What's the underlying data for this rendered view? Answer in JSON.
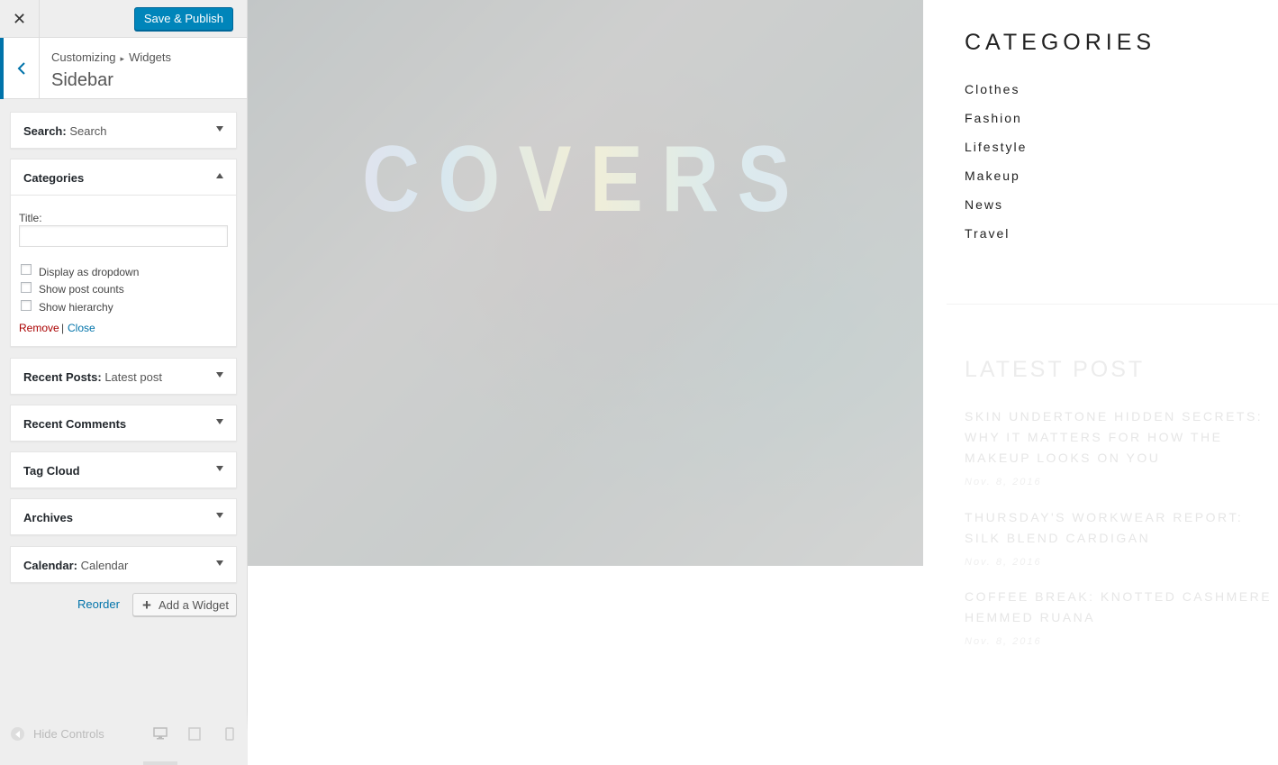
{
  "customizer": {
    "close_label": "✕",
    "publish_label": "Save & Publish",
    "breadcrumb": {
      "root": "Customizing",
      "separator": "▸",
      "current": "Widgets"
    },
    "section_title": "Sidebar",
    "widgets": [
      {
        "name": "Search",
        "subtitle": "Search",
        "expanded": false
      },
      {
        "name": "Categories",
        "subtitle": "",
        "expanded": true
      },
      {
        "name": "Recent Posts",
        "subtitle": "Latest post",
        "expanded": false
      },
      {
        "name": "Recent Comments",
        "subtitle": "",
        "expanded": false
      },
      {
        "name": "Tag Cloud",
        "subtitle": "",
        "expanded": false
      },
      {
        "name": "Archives",
        "subtitle": "",
        "expanded": false
      },
      {
        "name": "Calendar",
        "subtitle": "Calendar",
        "expanded": false
      }
    ],
    "categories_form": {
      "title_label": "Title:",
      "title_value": "",
      "options": [
        {
          "label": "Display as dropdown",
          "checked": false
        },
        {
          "label": "Show post counts",
          "checked": false
        },
        {
          "label": "Show hierarchy",
          "checked": false
        }
      ],
      "remove_label": "Remove",
      "divider": "|",
      "close_label": "Close"
    },
    "reorder_label": "Reorder",
    "add_widget_label": "Add a Widget",
    "hide_controls_label": "Hide Controls",
    "devices": [
      "desktop-icon",
      "tablet-icon",
      "mobile-icon"
    ]
  },
  "preview": {
    "hero_word": "COVERS",
    "categories_heading": "CATEGORIES",
    "categories": [
      "Clothes",
      "Fashion",
      "Lifestyle",
      "Makeup",
      "News",
      "Travel"
    ],
    "latest_heading": "LATEST POST",
    "posts": [
      {
        "title": "SKIN UNDERTONE HIDDEN SECRETS: WHY IT MATTERS FOR HOW THE MAKEUP LOOKS ON YOU",
        "date": "Nov. 8, 2016"
      },
      {
        "title": "THURSDAY'S WORKWEAR REPORT: SILK BLEND CARDIGAN",
        "date": "Nov. 8, 2016"
      },
      {
        "title": "COFFEE BREAK: KNOTTED CASHMERE HEMMED RUANA",
        "date": "Nov. 8, 2016"
      }
    ]
  },
  "colors": {
    "accent": "#0085ba",
    "link": "#0073aa",
    "remove": "#aa0000",
    "panel_bg": "#eeeeee"
  }
}
